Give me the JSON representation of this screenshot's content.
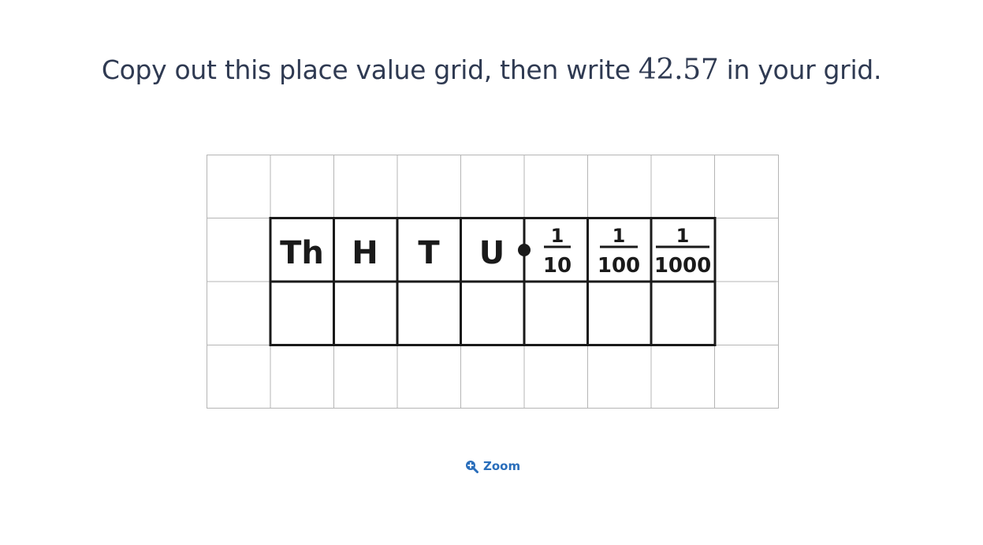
{
  "question": {
    "before": "Copy out this place value grid, then write ",
    "number": "42.57",
    "after": " in your grid."
  },
  "place_value_grid": {
    "headers": [
      "Th",
      "H",
      "T",
      "U"
    ],
    "fraction_headers": [
      {
        "numerator": "1",
        "denominator": "10"
      },
      {
        "numerator": "1",
        "denominator": "100"
      },
      {
        "numerator": "1",
        "denominator": "1000"
      }
    ],
    "row_cells": 7
  },
  "zoom": {
    "label": "Zoom",
    "icon": "zoom-in-icon"
  },
  "colors": {
    "text": "#2f3a52",
    "accent": "#2a6ebb",
    "grid_line": "#b5b5b5",
    "table_line": "#1a1a1a"
  }
}
